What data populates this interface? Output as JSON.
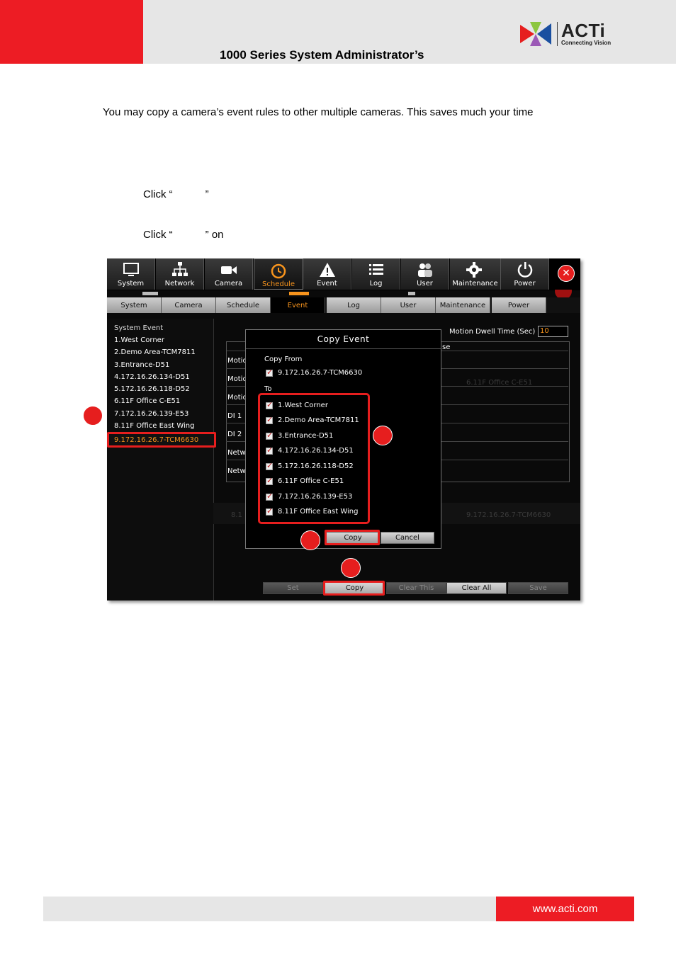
{
  "header": {
    "title": "1000 Series System Administrator’s",
    "logo_name": "ACTi",
    "logo_tagline": "Connecting Vision"
  },
  "body": {
    "paragraph": "You may copy a camera’s event rules to other multiple cameras. This saves much your time",
    "step1_prefix": "Click “",
    "step1_suffix": "”",
    "step2_prefix": "Click “",
    "step2_suffix": "” on"
  },
  "screenshot": {
    "top_nav": [
      "System",
      "Network",
      "Camera",
      "Schedule",
      "Event",
      "Log",
      "User",
      "Maintenance",
      "Power"
    ],
    "top_nav_active": "Schedule",
    "sub_nav": [
      "System",
      "Camera",
      "Schedule",
      "Event",
      "Log",
      "User",
      "Maintenance",
      "Power"
    ],
    "sub_nav_active": "Event",
    "sidebar": {
      "title": "System Event",
      "items": [
        "1.West Corner",
        "2.Demo Area-TCM7811",
        "3.Entrance-D51",
        "4.172.16.26.134-D51",
        "5.172.16.26.118-D52",
        "6.11F Office C-E51",
        "7.172.16.26.139-E53",
        "8.11F Office East Wing"
      ],
      "selected": "9.172.16.26.7-TCM6630"
    },
    "main": {
      "dwell_label": "Motion Dwell Time (Sec)",
      "dwell_value": "10",
      "response_fragment": "se",
      "rows": [
        "Motio",
        "Motio",
        "Motio",
        "DI 1",
        "DI 2",
        "Netw",
        "Netw"
      ],
      "ghost_right_1": "6.11F Office C-E51",
      "ghost_right_2": "9.172.16.26.7-TCM6630",
      "ghost_left": "8.1"
    },
    "bottom_buttons": [
      "Set",
      "Copy",
      "Clear This",
      "Clear All",
      "Save"
    ],
    "dialog": {
      "title": "Copy Event",
      "copy_from_label": "Copy From",
      "copy_from_value": "9.172.16.26.7-TCM6630",
      "to_label": "To",
      "targets": [
        "1.West Corner",
        "2.Demo Area-TCM7811",
        "3.Entrance-D51",
        "4.172.16.26.134-D51",
        "5.172.16.26.118-D52",
        "6.11F Office C-E51",
        "7.172.16.26.139-E53",
        "8.11F Office East Wing"
      ],
      "copy_button": "Copy",
      "cancel_button": "Cancel"
    }
  },
  "footer": {
    "url": "www.acti.com"
  },
  "colors": {
    "brand_red": "#ed1c24",
    "highlight_orange": "#f7941d",
    "header_gray": "#e6e6e6"
  }
}
